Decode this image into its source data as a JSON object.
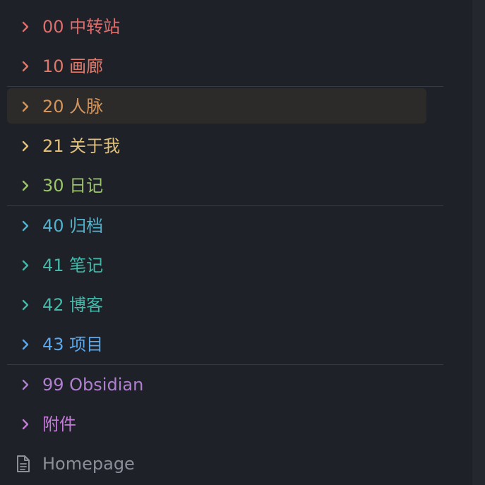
{
  "colors": {
    "background": "#1e2128",
    "active_row": "#2c2b2a",
    "divider": "#363a42",
    "scroll_gutter": "#24272e"
  },
  "tree": {
    "items": [
      {
        "label": "00 中转站",
        "color": "#e06c6c",
        "icon": "chevron-right-icon"
      },
      {
        "label": "10 画廊",
        "color": "#e0796a",
        "icon": "chevron-right-icon"
      },
      {
        "label": "20 人脉",
        "color": "#d4955c",
        "icon": "chevron-right-icon",
        "active": true
      },
      {
        "label": "21 关于我",
        "color": "#e2c07a",
        "icon": "chevron-right-icon"
      },
      {
        "label": "30 日记",
        "color": "#9cc46a",
        "icon": "chevron-right-icon"
      },
      {
        "label": "40 归档",
        "color": "#4fb3cf",
        "icon": "chevron-right-icon"
      },
      {
        "label": "41 笔记",
        "color": "#44b8a8",
        "icon": "chevron-right-icon"
      },
      {
        "label": "42 博客",
        "color": "#44b8a8",
        "icon": "chevron-right-icon"
      },
      {
        "label": "43 项目",
        "color": "#5aa8ee",
        "icon": "chevron-right-icon"
      },
      {
        "label": "99 Obsidian",
        "color": "#b07fcf",
        "icon": "chevron-right-icon"
      },
      {
        "label": "附件",
        "color": "#c77adb",
        "icon": "chevron-right-icon"
      },
      {
        "label": "Homepage",
        "color": "#8a8f98",
        "icon": "file-icon"
      }
    ]
  }
}
